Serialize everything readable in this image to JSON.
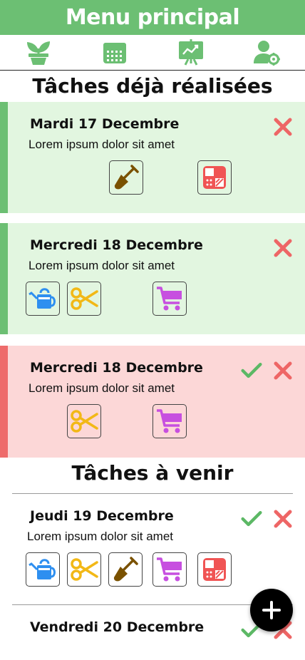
{
  "header": {
    "title": "Menu principal"
  },
  "nav": {
    "items": [
      {
        "icon": "plant-icon"
      },
      {
        "icon": "calendar-icon"
      },
      {
        "icon": "chart-board-icon"
      },
      {
        "icon": "user-settings-icon"
      }
    ]
  },
  "sections": {
    "done_title": "Tâches déjà réalisées",
    "upcoming_title": "Tâches à venir"
  },
  "cards": [
    {
      "date": "Mardi 17 Decembre",
      "desc": "Lorem ipsum dolor sit amet"
    },
    {
      "date": "Mercredi 18 Decembre",
      "desc": "Lorem ipsum dolor sit amet"
    },
    {
      "date": "Mercredi 18 Decembre",
      "desc": "Lorem ipsum dolor sit amet"
    },
    {
      "date": "Jeudi 19 Decembre",
      "desc": "Lorem ipsum dolor sit amet"
    },
    {
      "date": "Vendredi 20 Decembre"
    }
  ],
  "colors": {
    "primary_green": "#6cbf73",
    "done_bg": "#e2f6e0",
    "missed_bg": "#fcd7d7",
    "missed_accent": "#ee6b6b",
    "check": "#5cb865",
    "cross": "#ee6666",
    "watering": "#2e8ff0",
    "scissors": "#f2b816",
    "shovel": "#7a5100",
    "cart": "#c74fe0",
    "calc": "#f05454"
  }
}
